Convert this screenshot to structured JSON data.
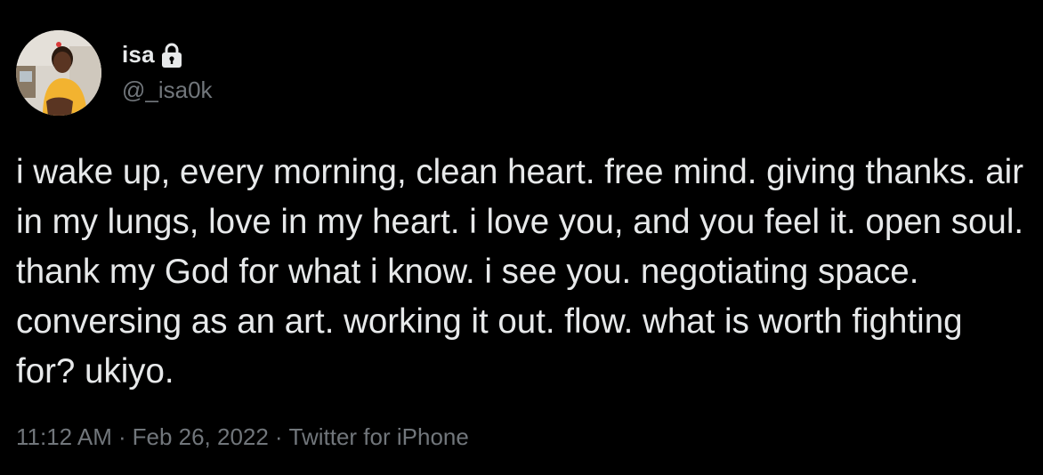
{
  "author": {
    "display_name": "isa",
    "handle": "@_isa0k",
    "protected": true,
    "avatar_icon": "profile-photo"
  },
  "tweet": {
    "text": "i wake up, every morning, clean heart. free mind. giving thanks. air in my lungs, love in my heart. i love you, and you feel it. open soul. thank my God for what i know. i see you. negotiating space. conversing as an art. working it out. flow. what is worth fighting for? ukiyo.",
    "time": "11:12 AM",
    "date": "Feb 26, 2022",
    "source": "Twitter for iPhone",
    "separator": "·"
  },
  "colors": {
    "background": "#000000",
    "primary_text": "#e7e9ea",
    "secondary_text": "#71767b"
  }
}
